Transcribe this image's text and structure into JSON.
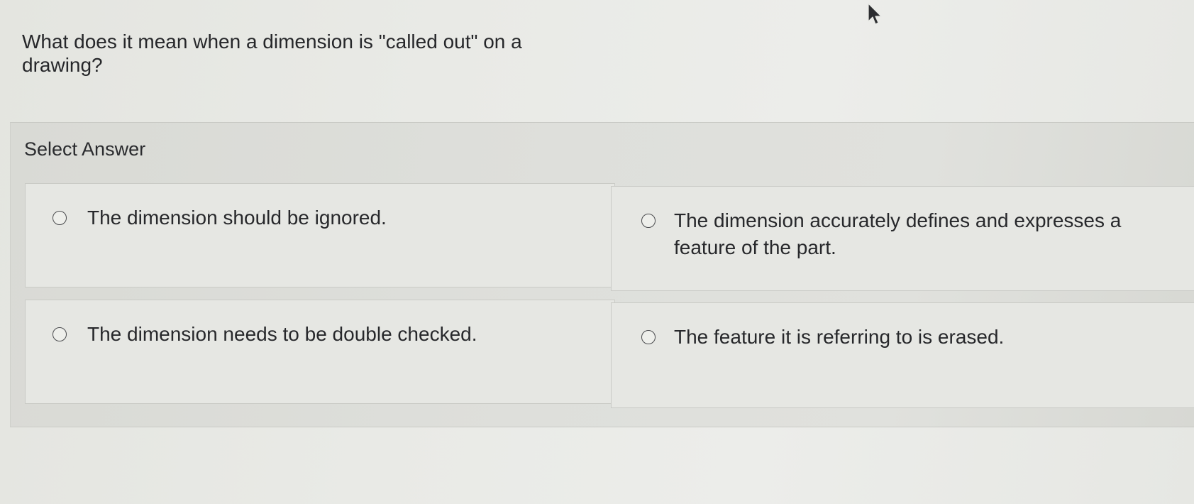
{
  "question": {
    "text": "What does it mean when a dimension is \"called out\" on a drawing?"
  },
  "answers": {
    "label": "Select Answer",
    "options": [
      {
        "text": "The dimension should be ignored.",
        "selected": false
      },
      {
        "text": "The dimension accurately defines and expresses a feature of the part.",
        "selected": false
      },
      {
        "text": "The dimension needs to be double checked.",
        "selected": false
      },
      {
        "text": "The feature it is referring to is erased.",
        "selected": false
      }
    ]
  },
  "icons": {
    "cursor": "mouse-pointer-icon",
    "radio": "radio-unchecked-icon"
  }
}
